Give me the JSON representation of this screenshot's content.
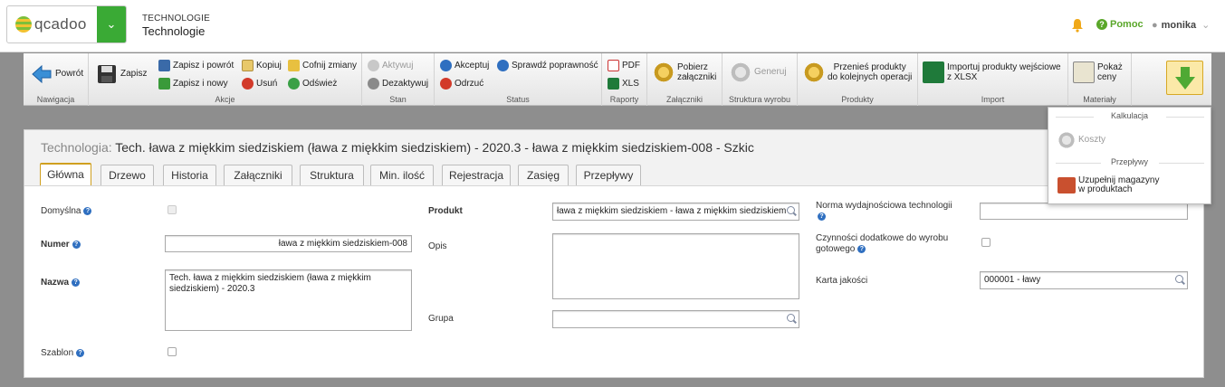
{
  "app": {
    "logo_text": "qcadoo",
    "breadcrumb_category": "TECHNOLOGIE",
    "breadcrumb_page": "Technologie"
  },
  "header": {
    "help_label": "Pomoc",
    "user_name": "monika"
  },
  "ribbon": {
    "groups": {
      "navigation": "Nawigacja",
      "actions": "Akcje",
      "state": "Stan",
      "status": "Status",
      "reports": "Raporty",
      "attachments": "Załączniki",
      "structure": "Struktura wyrobu",
      "products": "Produkty",
      "import": "Import",
      "materials": "Materiały"
    },
    "buttons": {
      "back": "Powrót",
      "save": "Zapisz",
      "save_back": "Zapisz i powrót",
      "save_new": "Zapisz i nowy",
      "copy": "Kopiuj",
      "delete": "Usuń",
      "undo": "Cofnij zmiany",
      "refresh": "Odśwież",
      "activate": "Aktywuj",
      "deactivate": "Dezaktywuj",
      "accept": "Akceptuj",
      "reject": "Odrzuć",
      "check": "Sprawdź poprawność",
      "pdf": "PDF",
      "xls": "XLS",
      "download_line1": "Pobierz",
      "download_line2": "załączniki",
      "generate": "Generuj",
      "move_line1": "Przenieś produkty",
      "move_line2": "do kolejnych operacji",
      "import_line1": "Importuj produkty wejściowe",
      "import_line2": "z XLSX",
      "prices_line1": "Pokaż",
      "prices_line2": "ceny"
    }
  },
  "dropdown": {
    "section_calc": "Kalkulacja",
    "costs": "Koszty",
    "section_flows": "Przepływy",
    "fill_line1": "Uzupełnij magazyny",
    "fill_line2": "w produktach"
  },
  "form": {
    "title_prefix": "Technologia:",
    "title": "Tech. ława z miękkim siedziskiem (ława z miękkim siedziskiem) - 2020.3 - ława z miękkim siedziskiem-008 - Szkic",
    "tabs": [
      "Główna",
      "Drzewo",
      "Historia",
      "Załączniki",
      "Struktura",
      "Min. ilość",
      "Rejestracja",
      "Zasięg",
      "Przepływy"
    ],
    "labels": {
      "default": "Domyślna",
      "number": "Numer",
      "name": "Nazwa",
      "template": "Szablon",
      "product": "Produkt",
      "description": "Opis",
      "group": "Grupa",
      "norm": "Norma wydajnościowa technologii",
      "extra_ops_line1": "Czynności dodatkowe do wyrobu",
      "extra_ops_line2": "gotowego",
      "quality_card": "Karta jakości"
    },
    "values": {
      "number": "ława z miękkim siedziskiem-008",
      "name": "Tech. ława z miękkim siedziskiem (ława z miękkim siedziskiem) - 2020.3",
      "product": "ława z miękkim siedziskiem - ława z miękkim siedziskiem",
      "description": "",
      "group": "",
      "norm": "",
      "quality_card": "000001 - ławy"
    }
  }
}
